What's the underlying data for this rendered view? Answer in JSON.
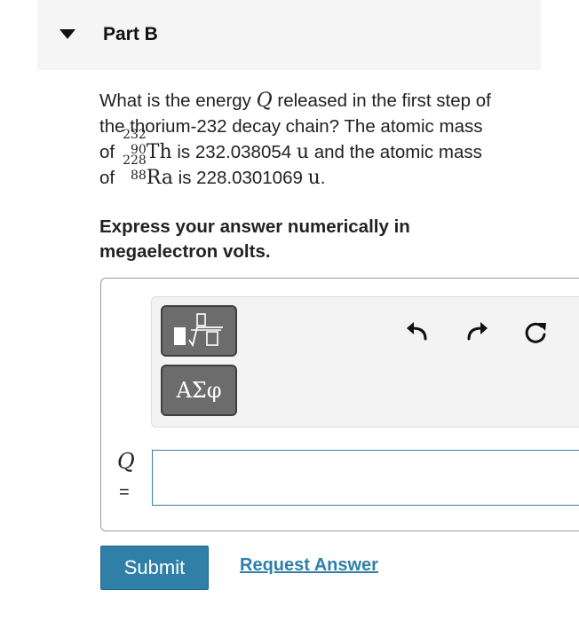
{
  "part": {
    "title": "Part B"
  },
  "question": {
    "line1_pre": "What is the energy ",
    "line1_var": "Q",
    "line1_post": " released in the first step of",
    "line2": "the thorium-232 decay chain? The atomic mass",
    "line3_pre": "of ",
    "th_mass": "232",
    "th_atomic": "90",
    "th_symbol": "Th",
    "line3_mid": " is 232.038054 ",
    "unit": "u",
    "line3_post": " and the atomic mass",
    "line4_pre": "of ",
    "ra_mass": "228",
    "ra_atomic": "88",
    "ra_symbol": "Ra",
    "line4_mid": " is 228.0301069 ",
    "line4_post": "."
  },
  "instructions": {
    "line1": "Express your answer numerically in",
    "line2": "megaelectron volts."
  },
  "toolbar": {
    "greek_button": "ΑΣφ",
    "template_icon": "fraction-sqrt-template-icon",
    "undo_icon": "undo-icon",
    "redo_icon": "redo-icon",
    "reset_icon": "reset-icon"
  },
  "answer": {
    "variable": "Q",
    "equals": "=",
    "value": ""
  },
  "actions": {
    "submit": "Submit",
    "request": "Request Answer"
  },
  "colors": {
    "accent": "#2f7fa8",
    "button_gray": "#6c6c6c",
    "header_bg": "#f5f5f5"
  }
}
